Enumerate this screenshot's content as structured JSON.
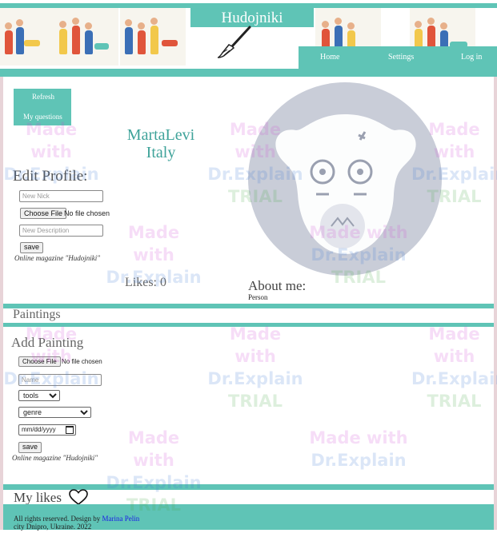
{
  "header": {
    "title": "Hudojniki",
    "nav": [
      {
        "label": "Home"
      },
      {
        "label": "Settings"
      },
      {
        "label": "Log in"
      }
    ]
  },
  "profile": {
    "refresh_label": "Refresh",
    "questions_label": "My questions",
    "name": "MartaLevi",
    "country": "Italy",
    "edit_heading": "Edit Profile:",
    "nick_placeholder": "New Nick",
    "choose_file_label": "Choose File",
    "no_file_label": "No file chosen",
    "description_placeholder": "New Description",
    "save_label": "save",
    "magazine_label": "Online magazine \"Hudojniki\"",
    "likes_label": "Likes: 0",
    "about_heading": "About me:",
    "about_value": "Person"
  },
  "paintings": {
    "heading": "Paintings",
    "add_heading": "Add Painting",
    "choose_file_label": "Choose File",
    "no_file_label": "No file chosen",
    "name_placeholder": "Name",
    "tools_selected": "tools",
    "genre_selected": "genre",
    "date_placeholder": "mm/dd/yyyy",
    "save_label": "save",
    "magazine_label": "Online magazine \"Hudojniki\""
  },
  "likes": {
    "heading": "My likes"
  },
  "footer": {
    "rights_text": "All rights reserved. Design by",
    "designer": "Marina Pelin",
    "city": "city Dnipro, Ukraine. 2022"
  },
  "watermark": {
    "line1": "Made with",
    "line2": "Dr.Explain",
    "line3": "TRIAL"
  },
  "colors": {
    "accent": "#5fc4b6",
    "link": "#1a1ae6",
    "avatar_bg": "#c9cdd8"
  },
  "icons": {
    "brush": "paintbrush-icon",
    "heart": "heart-outline-icon",
    "avatar": "default-avatar-icon",
    "calendar": "calendar-icon"
  }
}
